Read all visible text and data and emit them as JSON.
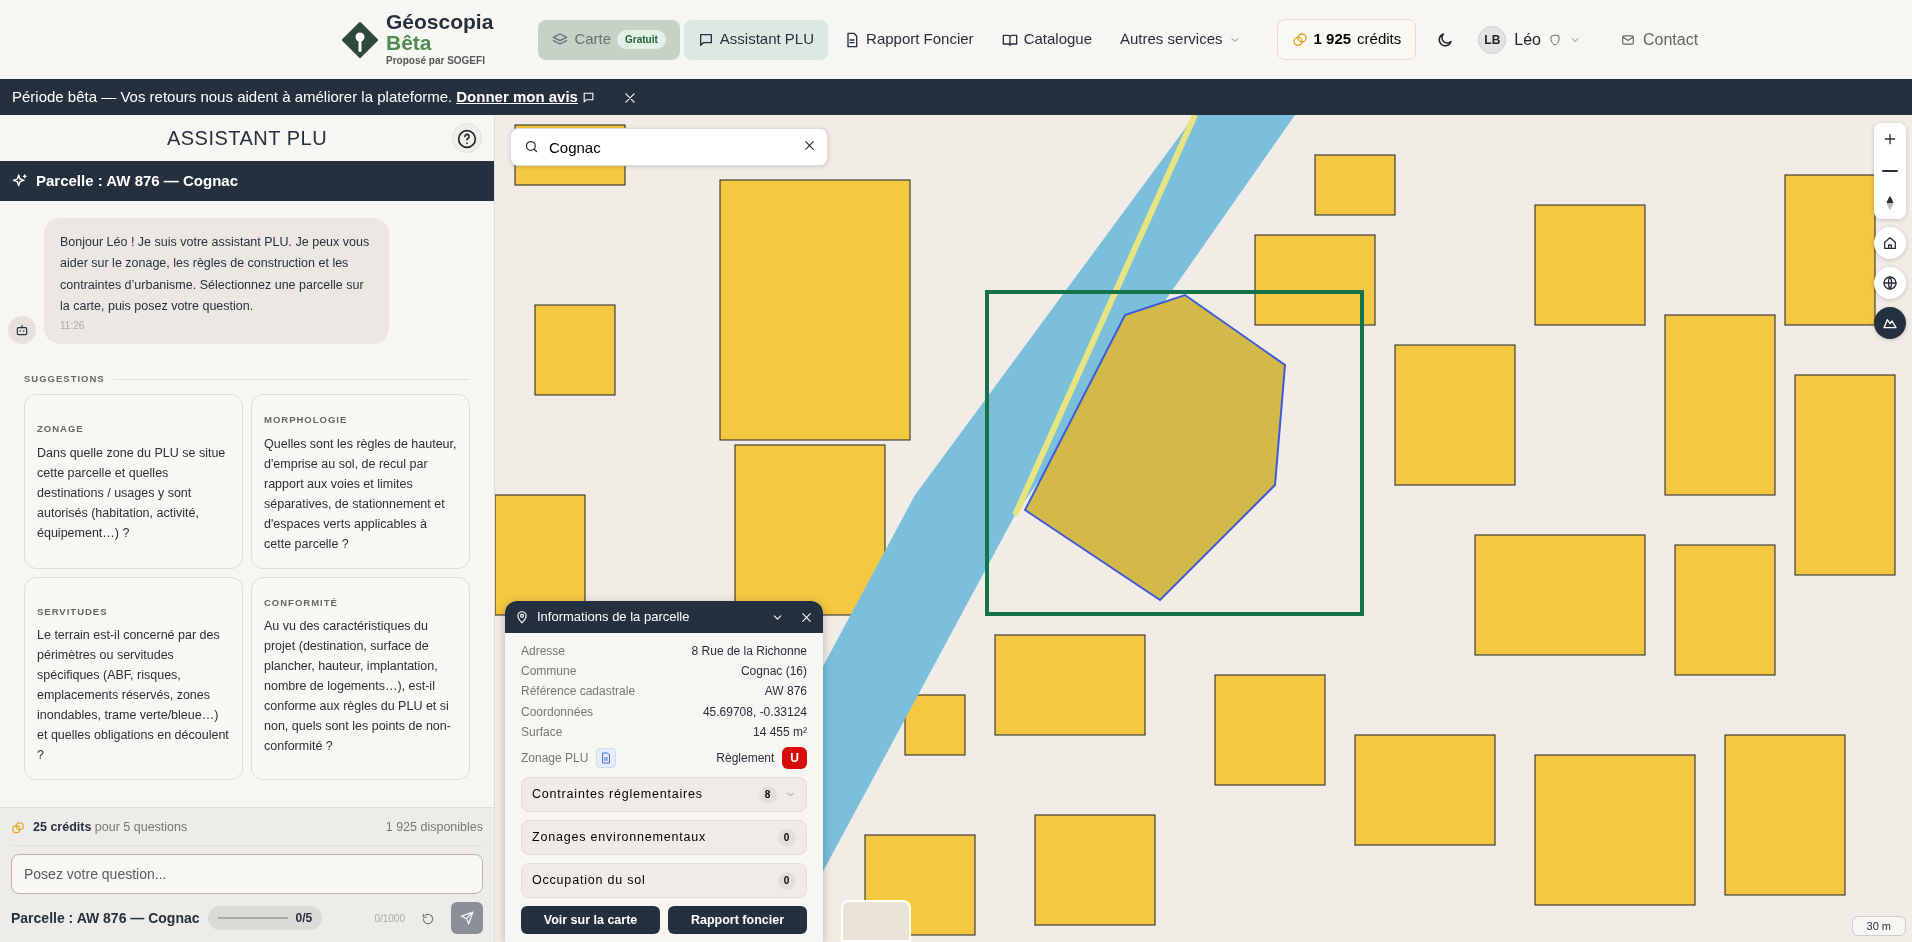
{
  "header": {
    "brand": {
      "name": "Géoscopia",
      "edition": "Bêta",
      "tagline": "Proposé par SOGEFI"
    },
    "nav": [
      {
        "label": "Carte",
        "badge": "Gratuit",
        "selected": false,
        "highlighted": true,
        "kind": "layers"
      },
      {
        "label": "Assistant PLU",
        "selected": true,
        "highlighted": false,
        "kind": "chat"
      },
      {
        "label": "Rapport Foncier",
        "selected": false,
        "highlighted": false,
        "kind": "doc"
      },
      {
        "label": "Catalogue",
        "selected": false,
        "highlighted": false,
        "kind": "book"
      },
      {
        "label": "Autres services",
        "selected": false,
        "highlighted": false,
        "kind": "menu"
      }
    ],
    "credits": {
      "amount": "1 925",
      "unit": "crédits"
    },
    "user": {
      "initials": "LB",
      "name": "Léo"
    },
    "contact": "Contact"
  },
  "banner": {
    "text": "Période bêta — Vos retours nous aident à améliorer la plateforme.",
    "link": "Donner mon avis"
  },
  "assistant": {
    "title": "ASSISTANT PLU",
    "parcel": "Parcelle : AW 876 — Cognac",
    "messages": [
      {
        "text": "Bonjour Léo ! Je suis votre assistant PLU. Je peux vous aider sur le zonage, les règles de construction et les contraintes d’urbanisme. Sélectionnez une parcelle sur la carte, puis posez votre question.",
        "time": "11:26"
      }
    ],
    "suggestions_label": "SUGGESTIONS",
    "suggestions": [
      {
        "title": "ZONAGE",
        "text": "Dans quelle zone du PLU se situe cette parcelle et quelles destinations / usages y sont autorisés (habitation, activité, équipement…) ?"
      },
      {
        "title": "MORPHOLOGIE",
        "text": "Quelles sont les règles de hauteur, d'emprise au sol, de recul par rapport aux voies et limites séparatives, de stationnement et d'espaces verts applicables à cette parcelle ?"
      },
      {
        "title": "SERVITUDES",
        "text": "Le terrain est-il concerné par des périmètres ou servitudes spécifiques (ABF, risques, emplacements réservés, zones inondables, trame verte/bleue…) et quelles obligations en découlent ?"
      },
      {
        "title": "CONFORMITÉ",
        "text": "Au vu des caractéristiques du projet (destination, surface de plancher, hauteur, implantation, nombre de logements…), est-il conforme aux règles du PLU et si non, quels sont les points de non-conformité ?"
      }
    ],
    "cost": {
      "amount": "25 crédits",
      "detail": "pour 5 questions",
      "available": "1 925 disponibles"
    },
    "input": {
      "placeholder": "Posez votre question..."
    },
    "footer": {
      "parcel": "Parcelle : AW 876 — Cognac",
      "quota": {
        "level": 0,
        "reading": "0/5"
      },
      "chars": "0/1000"
    }
  },
  "map": {
    "search": {
      "value": "Cognac"
    },
    "parcel_panel": {
      "title": "Informations de la parcelle",
      "rows": [
        {
          "label": "Adresse",
          "value": "8 Rue de la Richonne"
        },
        {
          "label": "Commune",
          "value": "Cognac (16)"
        },
        {
          "label": "Référence cadastrale",
          "value": "AW 876"
        },
        {
          "label": "Coordonnées",
          "value": "45.69708, -0.33124"
        },
        {
          "label": "Surface",
          "value": "14 455 m²"
        }
      ],
      "zoning": {
        "label": "Zonage PLU",
        "rule_label": "Règlement",
        "zone": "U"
      },
      "sections": [
        {
          "label": "Contraintes réglementaires",
          "count": "8",
          "expandable": true
        },
        {
          "label": "Zonages environnementaux",
          "count": "0",
          "expandable": false
        },
        {
          "label": "Occupation du sol",
          "count": "0",
          "expandable": false
        }
      ],
      "buttons": [
        "Voir sur la carte",
        "Rapport foncier"
      ]
    },
    "controls": [
      {
        "kind": "zoom-in",
        "selected": false
      },
      {
        "kind": "zoom-out",
        "selected": false
      },
      {
        "kind": "compass",
        "selected": false
      },
      {
        "kind": "home",
        "selected": false
      },
      {
        "kind": "globe",
        "selected": false
      },
      {
        "kind": "terrain",
        "selected": true
      }
    ],
    "scale": "30 m"
  }
}
